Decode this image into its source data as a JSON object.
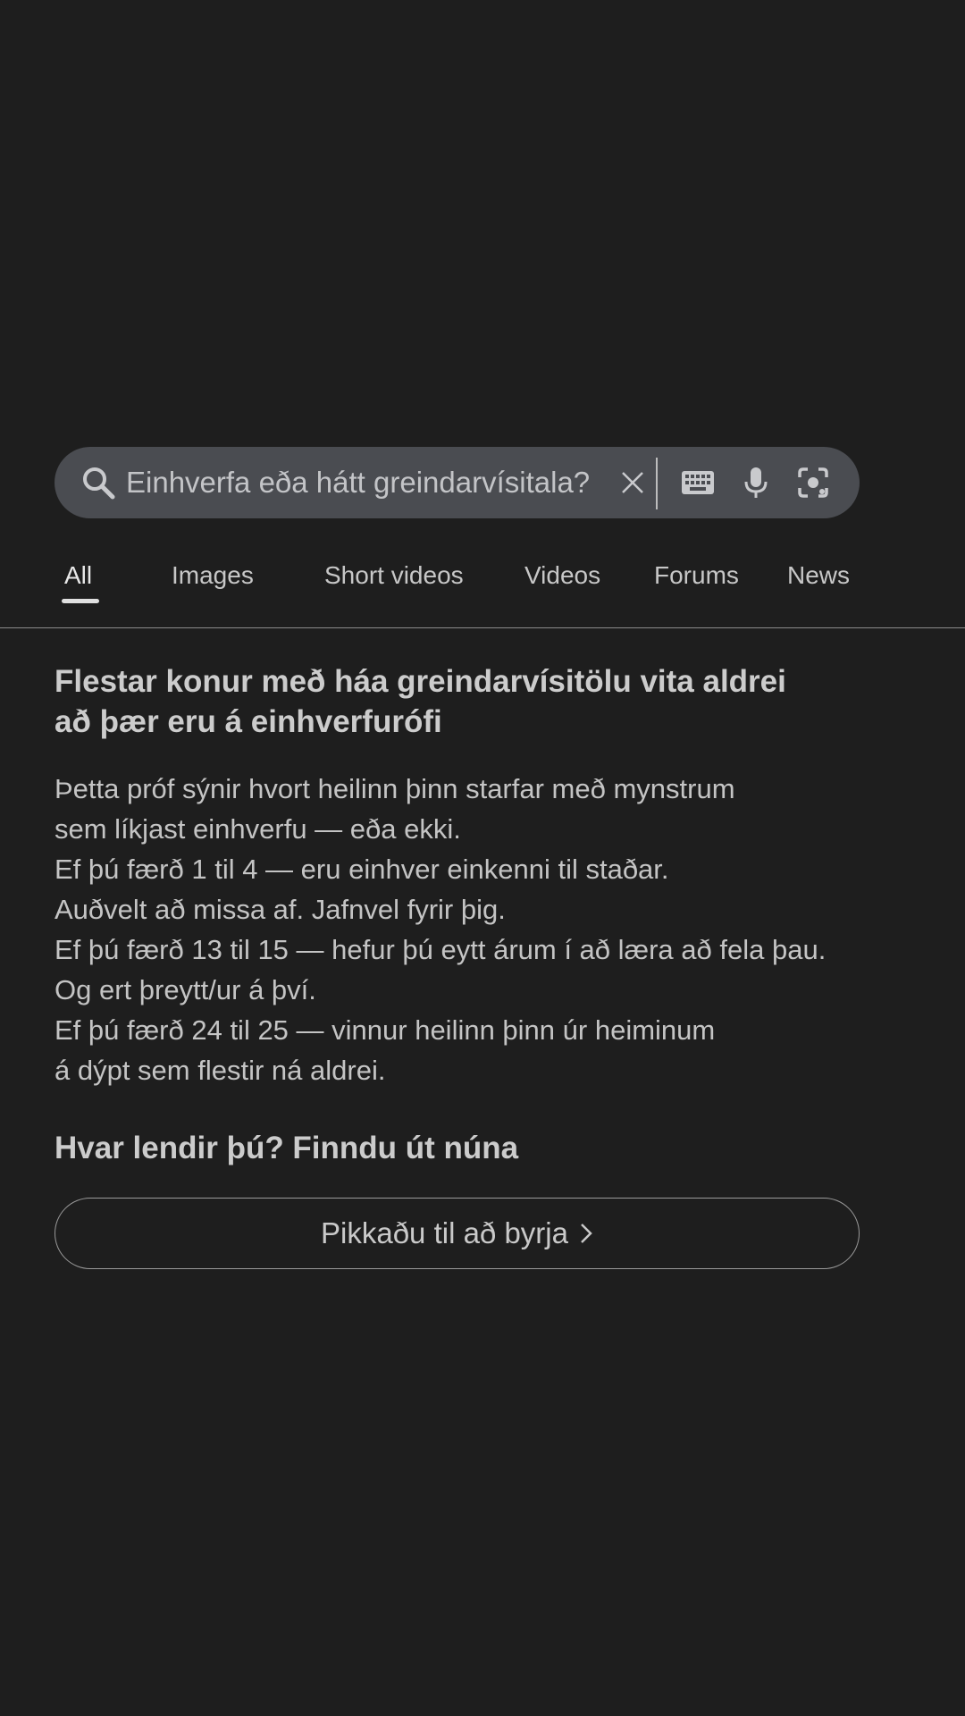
{
  "search": {
    "query": "Einhverfa eða hátt greindarvísitala?",
    "icons": [
      "search-icon",
      "close-icon",
      "keyboard-icon",
      "mic-icon",
      "lens-icon"
    ]
  },
  "tabs": [
    {
      "label": "All",
      "active": true
    },
    {
      "label": "Images",
      "active": false
    },
    {
      "label": "Short videos",
      "active": false
    },
    {
      "label": "Videos",
      "active": false
    },
    {
      "label": "Forums",
      "active": false
    },
    {
      "label": "News",
      "active": false
    }
  ],
  "content": {
    "headline_lines": [
      "Flestar konur með háa greindarvísitölu vita aldrei",
      "að þær eru á einhverfurófi"
    ],
    "body_lines": [
      "Þetta próf sýnir hvort heilinn þinn starfar með mynstrum",
      "sem líkjast einhverfu — eða ekki.",
      "Ef þú færð 1 til 4 — eru einhver einkenni til staðar.",
      "Auðvelt að missa af. Jafnvel fyrir þig.",
      "Ef þú færð 13 til 15 — hefur þú eytt árum í að læra að fela þau.",
      "Og ert þreytt/ur á því.",
      "Ef þú færð 24 til 25 — vinnur heilinn þinn úr heiminum",
      "á dýpt sem flestir ná aldrei."
    ],
    "cta_heading": "Hvar lendir þú? Finndu út núna",
    "cta_button_label": "Pikkaðu til að byrja"
  },
  "colors": {
    "background": "#1e1e1e",
    "search_bar": "#4a4c51",
    "text": "#c7c7c7"
  }
}
